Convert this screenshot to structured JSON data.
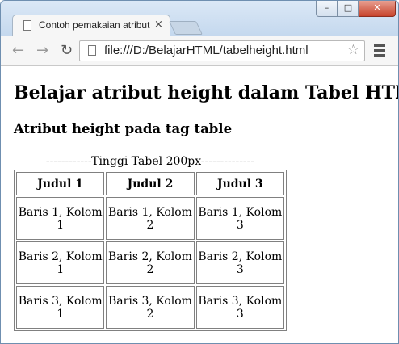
{
  "tab": {
    "title": "Contoh pemakaian atribut height",
    "close": "×"
  },
  "window_controls": {
    "minimize": "–",
    "maximize": "□",
    "close": "✕"
  },
  "nav": {
    "back": "←",
    "forward": "→",
    "reload": "↻"
  },
  "address_bar": {
    "url": "file:///D:/BelajarHTML/tabelheight.html",
    "star": "☆"
  },
  "page": {
    "heading": "Belajar atribut height dalam Tabel HTML",
    "subheading": "Atribut height pada tag table",
    "caption": "------------Tinggi Tabel 200px--------------",
    "table": {
      "headers": [
        "Judul 1",
        "Judul 2",
        "Judul 3"
      ],
      "rows": [
        [
          "Baris 1, Kolom 1",
          "Baris 1, Kolom 2",
          "Baris 1, Kolom 3"
        ],
        [
          "Baris 2, Kolom 1",
          "Baris 2, Kolom 2",
          "Baris 2, Kolom 3"
        ],
        [
          "Baris 3, Kolom 1",
          "Baris 3, Kolom 2",
          "Baris 3, Kolom 3"
        ]
      ]
    }
  }
}
